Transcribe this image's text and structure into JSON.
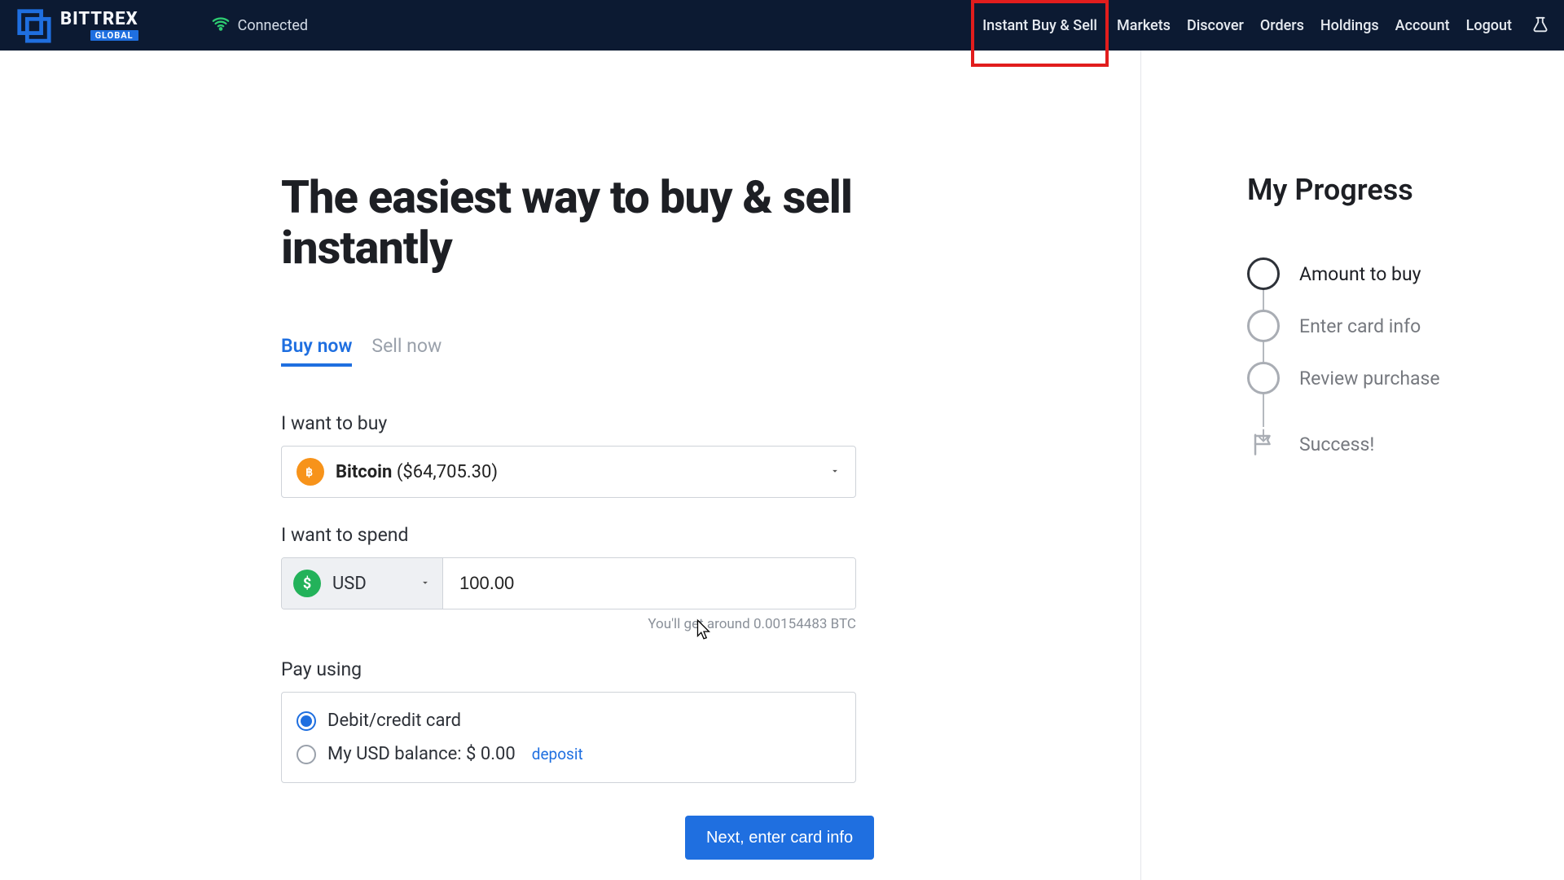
{
  "header": {
    "brand_main": "BITTREX",
    "brand_sub": "GLOBAL",
    "status": "Connected",
    "nav": {
      "instant": "Instant Buy & Sell",
      "markets": "Markets",
      "discover": "Discover",
      "orders": "Orders",
      "holdings": "Holdings",
      "account": "Account",
      "logout": "Logout"
    }
  },
  "main": {
    "title": "The easiest way to buy & sell instantly",
    "tabs": {
      "buy": "Buy now",
      "sell": "Sell now"
    },
    "buy_label": "I want to buy",
    "coin_name": "Bitcoin",
    "coin_price": "($64,705.30)",
    "spend_label": "I want to spend",
    "currency": "USD",
    "amount": "100.00",
    "estimate": "You'll get around 0.00154483 BTC",
    "pay_label": "Pay using",
    "pay_card": "Debit/credit card",
    "pay_balance": "My USD balance: $ 0.00",
    "deposit": "deposit",
    "next": "Next, enter card info"
  },
  "sidebar": {
    "title": "My Progress",
    "step1": "Amount to buy",
    "step2": "Enter card info",
    "step3": "Review purchase",
    "step4": "Success!"
  }
}
